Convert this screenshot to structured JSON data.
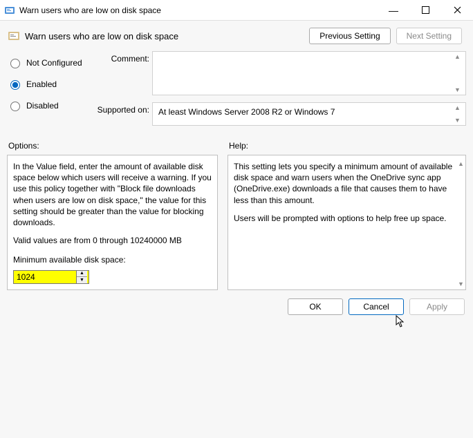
{
  "window": {
    "title": "Warn users who are low on disk space"
  },
  "header": {
    "title": "Warn users who are low on disk space",
    "prev_label": "Previous Setting",
    "next_label": "Next Setting"
  },
  "state": {
    "not_configured_label": "Not Configured",
    "enabled_label": "Enabled",
    "disabled_label": "Disabled",
    "selected": "enabled"
  },
  "comment": {
    "label": "Comment:",
    "value": ""
  },
  "supported": {
    "label": "Supported on:",
    "value": "At least Windows Server 2008 R2 or Windows 7"
  },
  "options": {
    "label": "Options:",
    "body_p1": "In the Value field, enter the amount of available disk space below which users will receive a warning. If you use this policy together with \"Block file downloads when users are low on disk space,\" the value for this setting should be greater than the value for blocking downloads.",
    "body_p2": "Valid values are from 0 through 10240000 MB",
    "min_label": "Minimum available disk space:",
    "min_value": "1024"
  },
  "help": {
    "label": "Help:",
    "body_p1": "This setting lets you specify a minimum amount of available disk space and warn users when the OneDrive sync app (OneDrive.exe) downloads a file that causes them to have less than this amount.",
    "body_p2": "Users will be prompted with options to help free up space."
  },
  "footer": {
    "ok": "OK",
    "cancel": "Cancel",
    "apply": "Apply"
  }
}
